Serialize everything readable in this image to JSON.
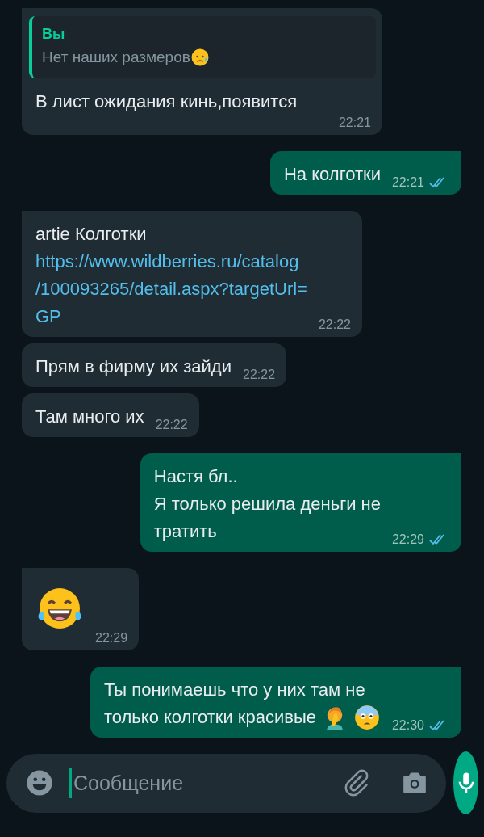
{
  "messages": [
    {
      "outgoing": false,
      "tail": true,
      "quote": {
        "author": "Вы",
        "text": "Нет наших размеров",
        "emoji": [
          {
            "kind": "sad"
          }
        ]
      },
      "lines": [
        {
          "kind": "text",
          "text": "В лист ожидания кинь,появится"
        }
      ],
      "time": "22:21"
    },
    {
      "outgoing": true,
      "tail": true,
      "lines": [
        {
          "kind": "text",
          "text": "На колготки"
        }
      ],
      "time": "22:21",
      "read": true
    },
    {
      "outgoing": false,
      "tail": true,
      "lines": [
        {
          "kind": "text",
          "text": "artie Колготки"
        },
        {
          "kind": "link",
          "text": "https://www.wildberries.ru/catalog"
        },
        {
          "kind": "link",
          "text": "/100093265/detail.aspx?targetUrl="
        },
        {
          "kind": "link",
          "text": "GP"
        }
      ],
      "time": "22:22"
    },
    {
      "outgoing": false,
      "tail": false,
      "lines": [
        {
          "kind": "text",
          "text": "Прям в фирму их зайди"
        }
      ],
      "time": "22:22"
    },
    {
      "outgoing": false,
      "tail": false,
      "lines": [
        {
          "kind": "text",
          "text": "Там много их"
        }
      ],
      "time": "22:22"
    },
    {
      "outgoing": true,
      "tail": true,
      "lines": [
        {
          "kind": "text",
          "text": "Настя бл.."
        },
        {
          "kind": "text",
          "text": "Я только решила деньги не"
        },
        {
          "kind": "text",
          "text": "тратить"
        }
      ],
      "time": "22:29",
      "read": true
    },
    {
      "outgoing": false,
      "tail": true,
      "emoji": [
        {
          "kind": "laughing"
        }
      ],
      "time": "22:29"
    },
    {
      "outgoing": true,
      "tail": true,
      "lines": [
        {
          "kind": "text",
          "text": "Ты понимаешь что у них там не"
        },
        {
          "kind": "text",
          "text": "только колготки красивые"
        }
      ],
      "emoji": [
        {
          "kind": "facepalm"
        },
        {
          "kind": "shocked"
        }
      ],
      "time": "22:30",
      "read": true
    }
  ],
  "composer": {
    "placeholder": "Сообщение"
  }
}
